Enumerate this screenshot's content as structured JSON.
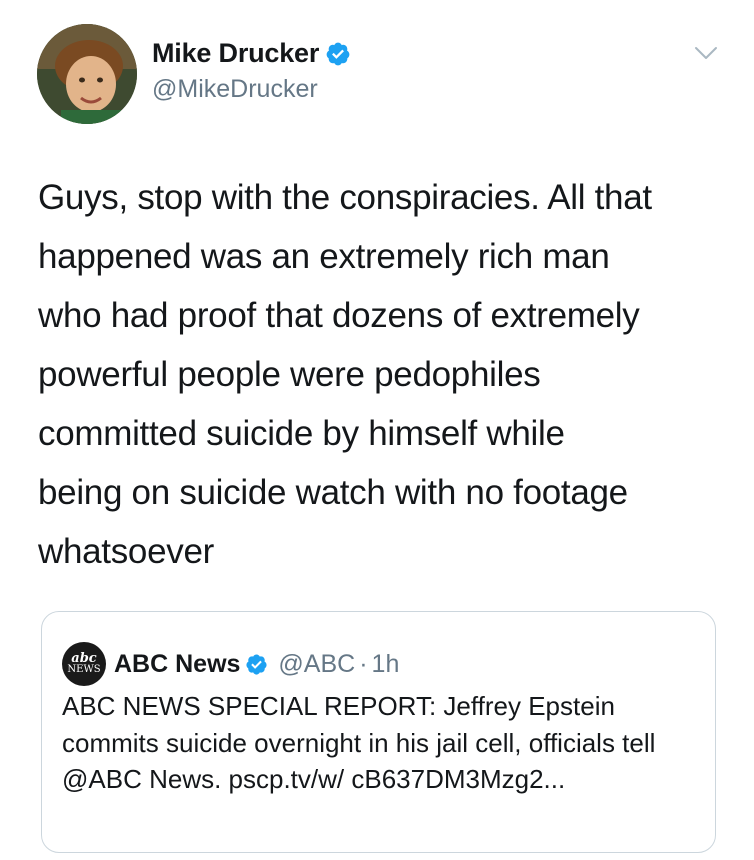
{
  "author": {
    "display_name": "Mike Drucker",
    "handle": "@MikeDrucker",
    "verified_icon": "verified-badge-icon"
  },
  "tweet": {
    "text": "Guys, stop with the conspiracies. All that\nhappened was an extremely rich man\nwho had proof that dozens of extremely\npowerful people were pedophiles\ncommitted suicide by himself while\nbeing on suicide watch with no footage\nwhatsoever"
  },
  "quoted_tweet": {
    "display_name": "ABC News",
    "handle": "@ABC",
    "separator": "·",
    "time": "1h",
    "logo_mark": "abc",
    "logo_sub": "NEWS",
    "text": "ABC NEWS SPECIAL REPORT: Jeffrey Epstein commits suicide overnight in his jail cell, officials tell @ABC News. pscp.tv/w/ cB637DM3Mzg2..."
  },
  "colors": {
    "verified_blue": "#1da1f2",
    "secondary_text": "#657786",
    "primary_text": "#14171a",
    "border": "#ccd6dd"
  }
}
